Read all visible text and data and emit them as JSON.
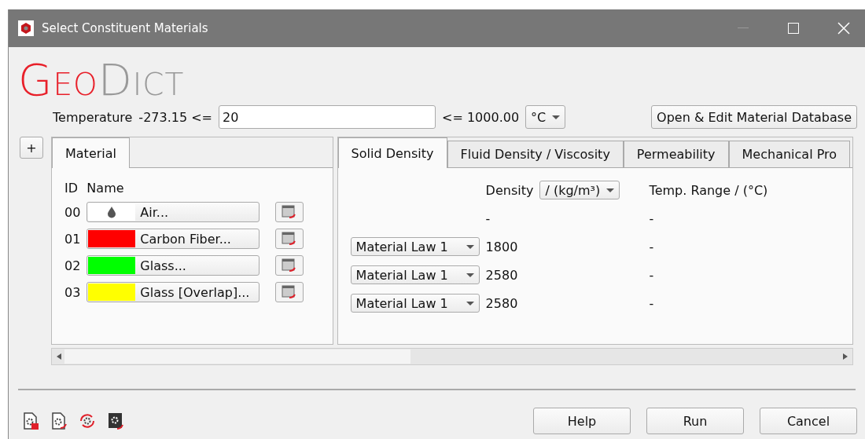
{
  "window": {
    "title": "Select Constituent Materials"
  },
  "logo": {
    "part_1": "Geo",
    "part_2": "Dict"
  },
  "temperature": {
    "label": "Temperature",
    "min": "-273.15 <=",
    "value": "20",
    "max": "<= 1000.00",
    "unit": "°C"
  },
  "database_button": "Open & Edit Material Database",
  "add_button": "+",
  "left_tabs": [
    {
      "label": "Material",
      "selected": true
    }
  ],
  "material_columns": [
    "ID",
    "Name"
  ],
  "materials": [
    {
      "id": "00",
      "name": "Air...",
      "kind": "fluid"
    },
    {
      "id": "01",
      "name": "Carbon Fiber...",
      "kind": "solid",
      "color": "#ff0000"
    },
    {
      "id": "02",
      "name": "Glass...",
      "kind": "solid",
      "color": "#00ff00"
    },
    {
      "id": "03",
      "name": "Glass [Overlap]...",
      "kind": "solid",
      "color": "#ffff00"
    }
  ],
  "right_tabs": [
    {
      "label": "Solid Density",
      "selected": true
    },
    {
      "label": "Fluid Density / Viscosity",
      "selected": false
    },
    {
      "label": "Permeability",
      "selected": false
    },
    {
      "label": "Mechanical Pro",
      "selected": false
    }
  ],
  "density_header": {
    "label": "Density",
    "unit": "/ (kg/m³)",
    "range": "Temp. Range / (°C)"
  },
  "density_rows": [
    {
      "density": "-",
      "range": "-"
    },
    {
      "law": "Material Law 1",
      "density": "1800",
      "range": "-"
    },
    {
      "law": "Material Law 1",
      "density": "2580",
      "range": "-"
    },
    {
      "law": "Material Law 1",
      "density": "2580",
      "range": "-"
    }
  ],
  "buttons": [
    "Help",
    "Run",
    "Cancel"
  ]
}
